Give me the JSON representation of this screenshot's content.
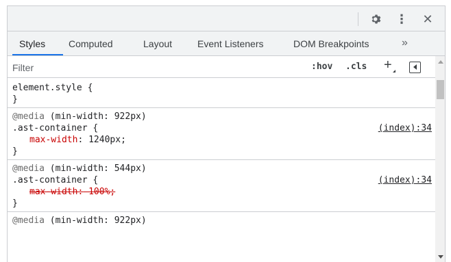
{
  "toolbar": {
    "settings_icon": "gear-icon",
    "menu_icon": "kebab-menu-icon",
    "close_icon": "close-icon",
    "menu_glyph": "⋮",
    "close_glyph": "✕"
  },
  "tabs": [
    {
      "label": "Styles",
      "active": true
    },
    {
      "label": "Computed",
      "active": false
    },
    {
      "label": "Layout",
      "active": false
    },
    {
      "label": "Event Listeners",
      "active": false
    },
    {
      "label": "DOM Breakpoints",
      "active": false
    }
  ],
  "tabs_more_glyph": "»",
  "filter": {
    "placeholder": "Filter",
    "value": "",
    "hov_label": ":hov",
    "cls_label": ".cls",
    "plus_glyph": "+"
  },
  "rules": [
    {
      "selector": "element.style {",
      "close": "}"
    },
    {
      "media_kw": "@media",
      "media_query": " (min-width: 922px)",
      "selector": ".ast-container {",
      "source": "(index):34",
      "prop": "max-width",
      "value": " 1240px;",
      "overridden": false,
      "close": "}"
    },
    {
      "media_kw": "@media",
      "media_query": " (min-width: 544px)",
      "selector": ".ast-container {",
      "source": "(index):34",
      "prop": "max-width",
      "value": " 100%;",
      "overridden": true,
      "close": "}"
    },
    {
      "media_kw": "@media",
      "media_query": " (min-width: 922px)"
    }
  ],
  "colors": {
    "accent": "#1a73e8",
    "property_name": "#c80000",
    "media_keyword": "#6a6a6a"
  }
}
